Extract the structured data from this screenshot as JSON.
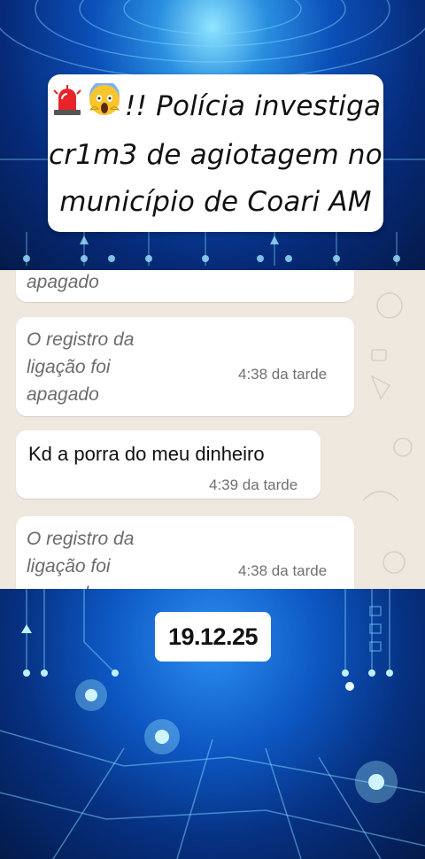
{
  "banner": {
    "emojis": [
      "police-siren-icon",
      "screaming-face-icon"
    ],
    "title_line1": "!! Polícia investiga",
    "title_line2": "cr1m3 de agiotagem no",
    "title_line3": "município de Coari AM"
  },
  "chat": {
    "messages": [
      {
        "text": "apagado",
        "time": ""
      },
      {
        "text_lines": [
          "O registro da",
          "ligação foi",
          "apagado"
        ],
        "time": "4:38 da tarde"
      },
      {
        "text": "Kd a porra do meu dinheiro",
        "time": "4:39 da tarde"
      },
      {
        "text_lines": [
          "O registro da",
          "ligação foi",
          "apagado"
        ],
        "time": "4:38 da tarde"
      }
    ]
  },
  "date_label": "19.12.25",
  "colors": {
    "chat_bg": "#efe8df",
    "bubble": "#ffffff",
    "tech_blue": "#0b4fb8"
  }
}
